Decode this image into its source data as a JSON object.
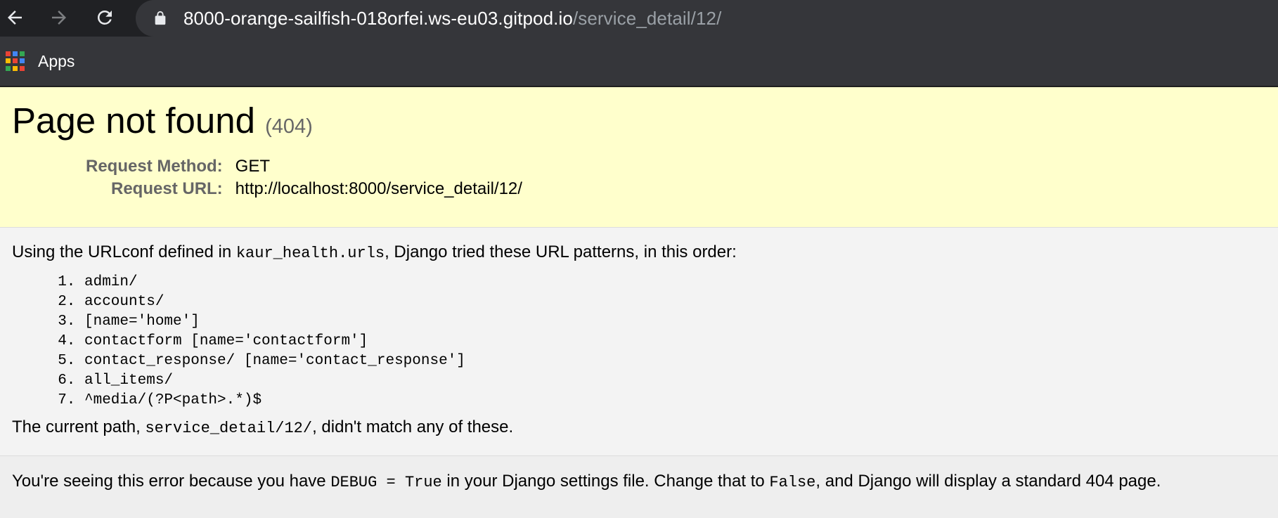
{
  "browser": {
    "url_host": "8000-orange-sailfish-018orfei.ws-eu03.gitpod.io",
    "url_path": "/service_detail/12/",
    "bookmarks": {
      "apps_label": "Apps"
    },
    "icons": [
      "back-arrow-icon",
      "forward-arrow-icon",
      "reload-icon",
      "lock-icon",
      "apps-grid-icon"
    ]
  },
  "page": {
    "title": "Page not found",
    "status_code": "(404)",
    "request_method_label": "Request Method:",
    "request_method": "GET",
    "request_url_label": "Request URL:",
    "request_url": "http://localhost:8000/service_detail/12/",
    "urlconf_intro_before": "Using the URLconf defined in ",
    "urlconf_name": "kaur_health.urls",
    "urlconf_intro_after": ", Django tried these URL patterns, in this order:",
    "patterns": [
      "admin/",
      "accounts/",
      "[name='home']",
      "contactform [name='contactform']",
      "contact_response/ [name='contact_response']",
      "all_items/",
      "^media/(?P<path>.*)$"
    ],
    "current_path_before": "The current path, ",
    "current_path": "service_detail/12/",
    "current_path_after": ", didn't match any of these.",
    "debug_before": "You're seeing this error because you have ",
    "debug_setting": "DEBUG = True",
    "debug_middle": " in your Django settings file. Change that to ",
    "debug_false": "False",
    "debug_after": ", and Django will display a standard 404 page."
  },
  "colors": {
    "chrome_dark": "#202124",
    "omnibox": "#35363a",
    "summary_bg": "#ffffcc",
    "apps_icon": [
      "#ea4335",
      "#4285f4",
      "#34a853",
      "#fbbc05",
      "#ea4335",
      "#4285f4",
      "#34a853",
      "#fbbc05",
      "#ea4335"
    ]
  }
}
